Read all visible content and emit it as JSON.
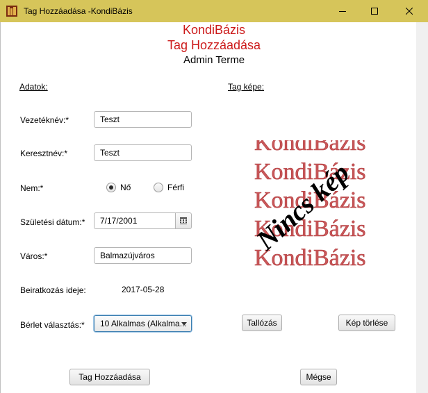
{
  "window": {
    "title": "Tag Hozzáadása -KondiBázis",
    "minimize_icon": "minimize-icon",
    "maximize_icon": "maximize-icon",
    "close_icon": "close-icon"
  },
  "header": {
    "brand": "KondiBázis",
    "page_title": "Tag Hozzáadása",
    "subtitle": "Admin Terme"
  },
  "form": {
    "section_label": "Adatok:",
    "last_name": {
      "label": "Vezetéknév:*",
      "value": "Teszt"
    },
    "first_name": {
      "label": "Keresztnév:*",
      "value": "Teszt"
    },
    "gender": {
      "label": "Nem:*",
      "options": [
        "Nő",
        "Férfi"
      ],
      "selected": "Nő"
    },
    "birth_date": {
      "label": "Születési dátum:*",
      "value": "7/17/2001",
      "icon": "calendar-icon"
    },
    "city": {
      "label": "Város:*",
      "value": "Balmazújváros"
    },
    "enrollment": {
      "label": "Beiratkozás ideje:",
      "value": "2017-05-28"
    },
    "pass": {
      "label": "Bérlet választás:*",
      "value": "10 Alkalmas (Alkalma..."
    }
  },
  "image_panel": {
    "label": "Tag képe:",
    "placeholder_word": "KondiBázis",
    "placeholder_overlay": "Nincs kép",
    "browse_label": "Tallózás",
    "delete_label": "Kép törlése"
  },
  "actions": {
    "submit_label": "Tag Hozzáadása",
    "cancel_label": "Mégse"
  },
  "colors": {
    "titlebar": "#d6c55a",
    "brand_red": "#cc1a1a",
    "placeholder_red": "#c9585a"
  }
}
